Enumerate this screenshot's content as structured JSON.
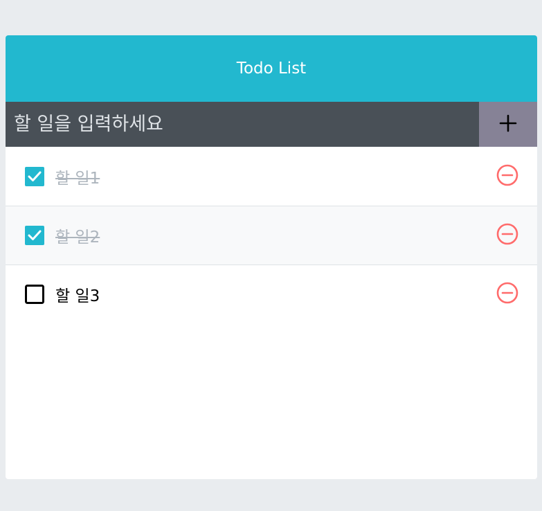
{
  "header": {
    "title": "Todo List"
  },
  "insert": {
    "placeholder": "할 일을 입력하세요",
    "value": "",
    "button_icon": "plus-icon"
  },
  "todos": [
    {
      "text": "할 일1",
      "checked": true
    },
    {
      "text": "할 일2",
      "checked": true
    },
    {
      "text": "할 일3",
      "checked": false
    }
  ],
  "colors": {
    "page_background": "#e9ecef",
    "header": "#22b8cf",
    "insert_background": "#495057",
    "insert_button": "#868296",
    "checked_checkbox": "#22b8cf",
    "checked_text": "#adb5bd",
    "remove_icon": "#ff6b6b",
    "item_alt_background": "#f8f9fa"
  },
  "icons": {
    "checked": "checkbox-checked-icon",
    "unchecked": "checkbox-unchecked-icon",
    "remove": "minus-circle-icon"
  }
}
